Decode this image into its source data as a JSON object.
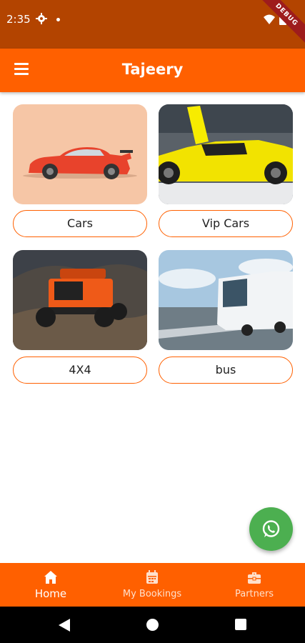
{
  "status_bar": {
    "time": "2:35",
    "ribbon": "DEBUG",
    "icons": [
      "gear-icon",
      "dot-icon",
      "wifi-icon",
      "battery-icon"
    ]
  },
  "app_bar": {
    "title": "Tajeery",
    "menu_icon": "menu-icon"
  },
  "categories": [
    {
      "label": "Cars",
      "image": "red sports car illustration"
    },
    {
      "label": "Vip Cars",
      "image": "yellow supercar with open doors"
    },
    {
      "label": "4X4",
      "image": "orange off-road jeep"
    },
    {
      "label": "bus",
      "image": "white coach bus on road"
    }
  ],
  "fab": {
    "icon": "whatsapp-icon"
  },
  "bottom_nav": {
    "items": [
      {
        "label": "Home",
        "icon": "home-icon",
        "active": true
      },
      {
        "label": "My Bookings",
        "icon": "calendar-icon",
        "active": false
      },
      {
        "label": "Partners",
        "icon": "briefcase-icon",
        "active": false
      }
    ]
  },
  "colors": {
    "primary": "#ff6000",
    "status_bar": "#b34400",
    "fab": "#4caf50"
  }
}
